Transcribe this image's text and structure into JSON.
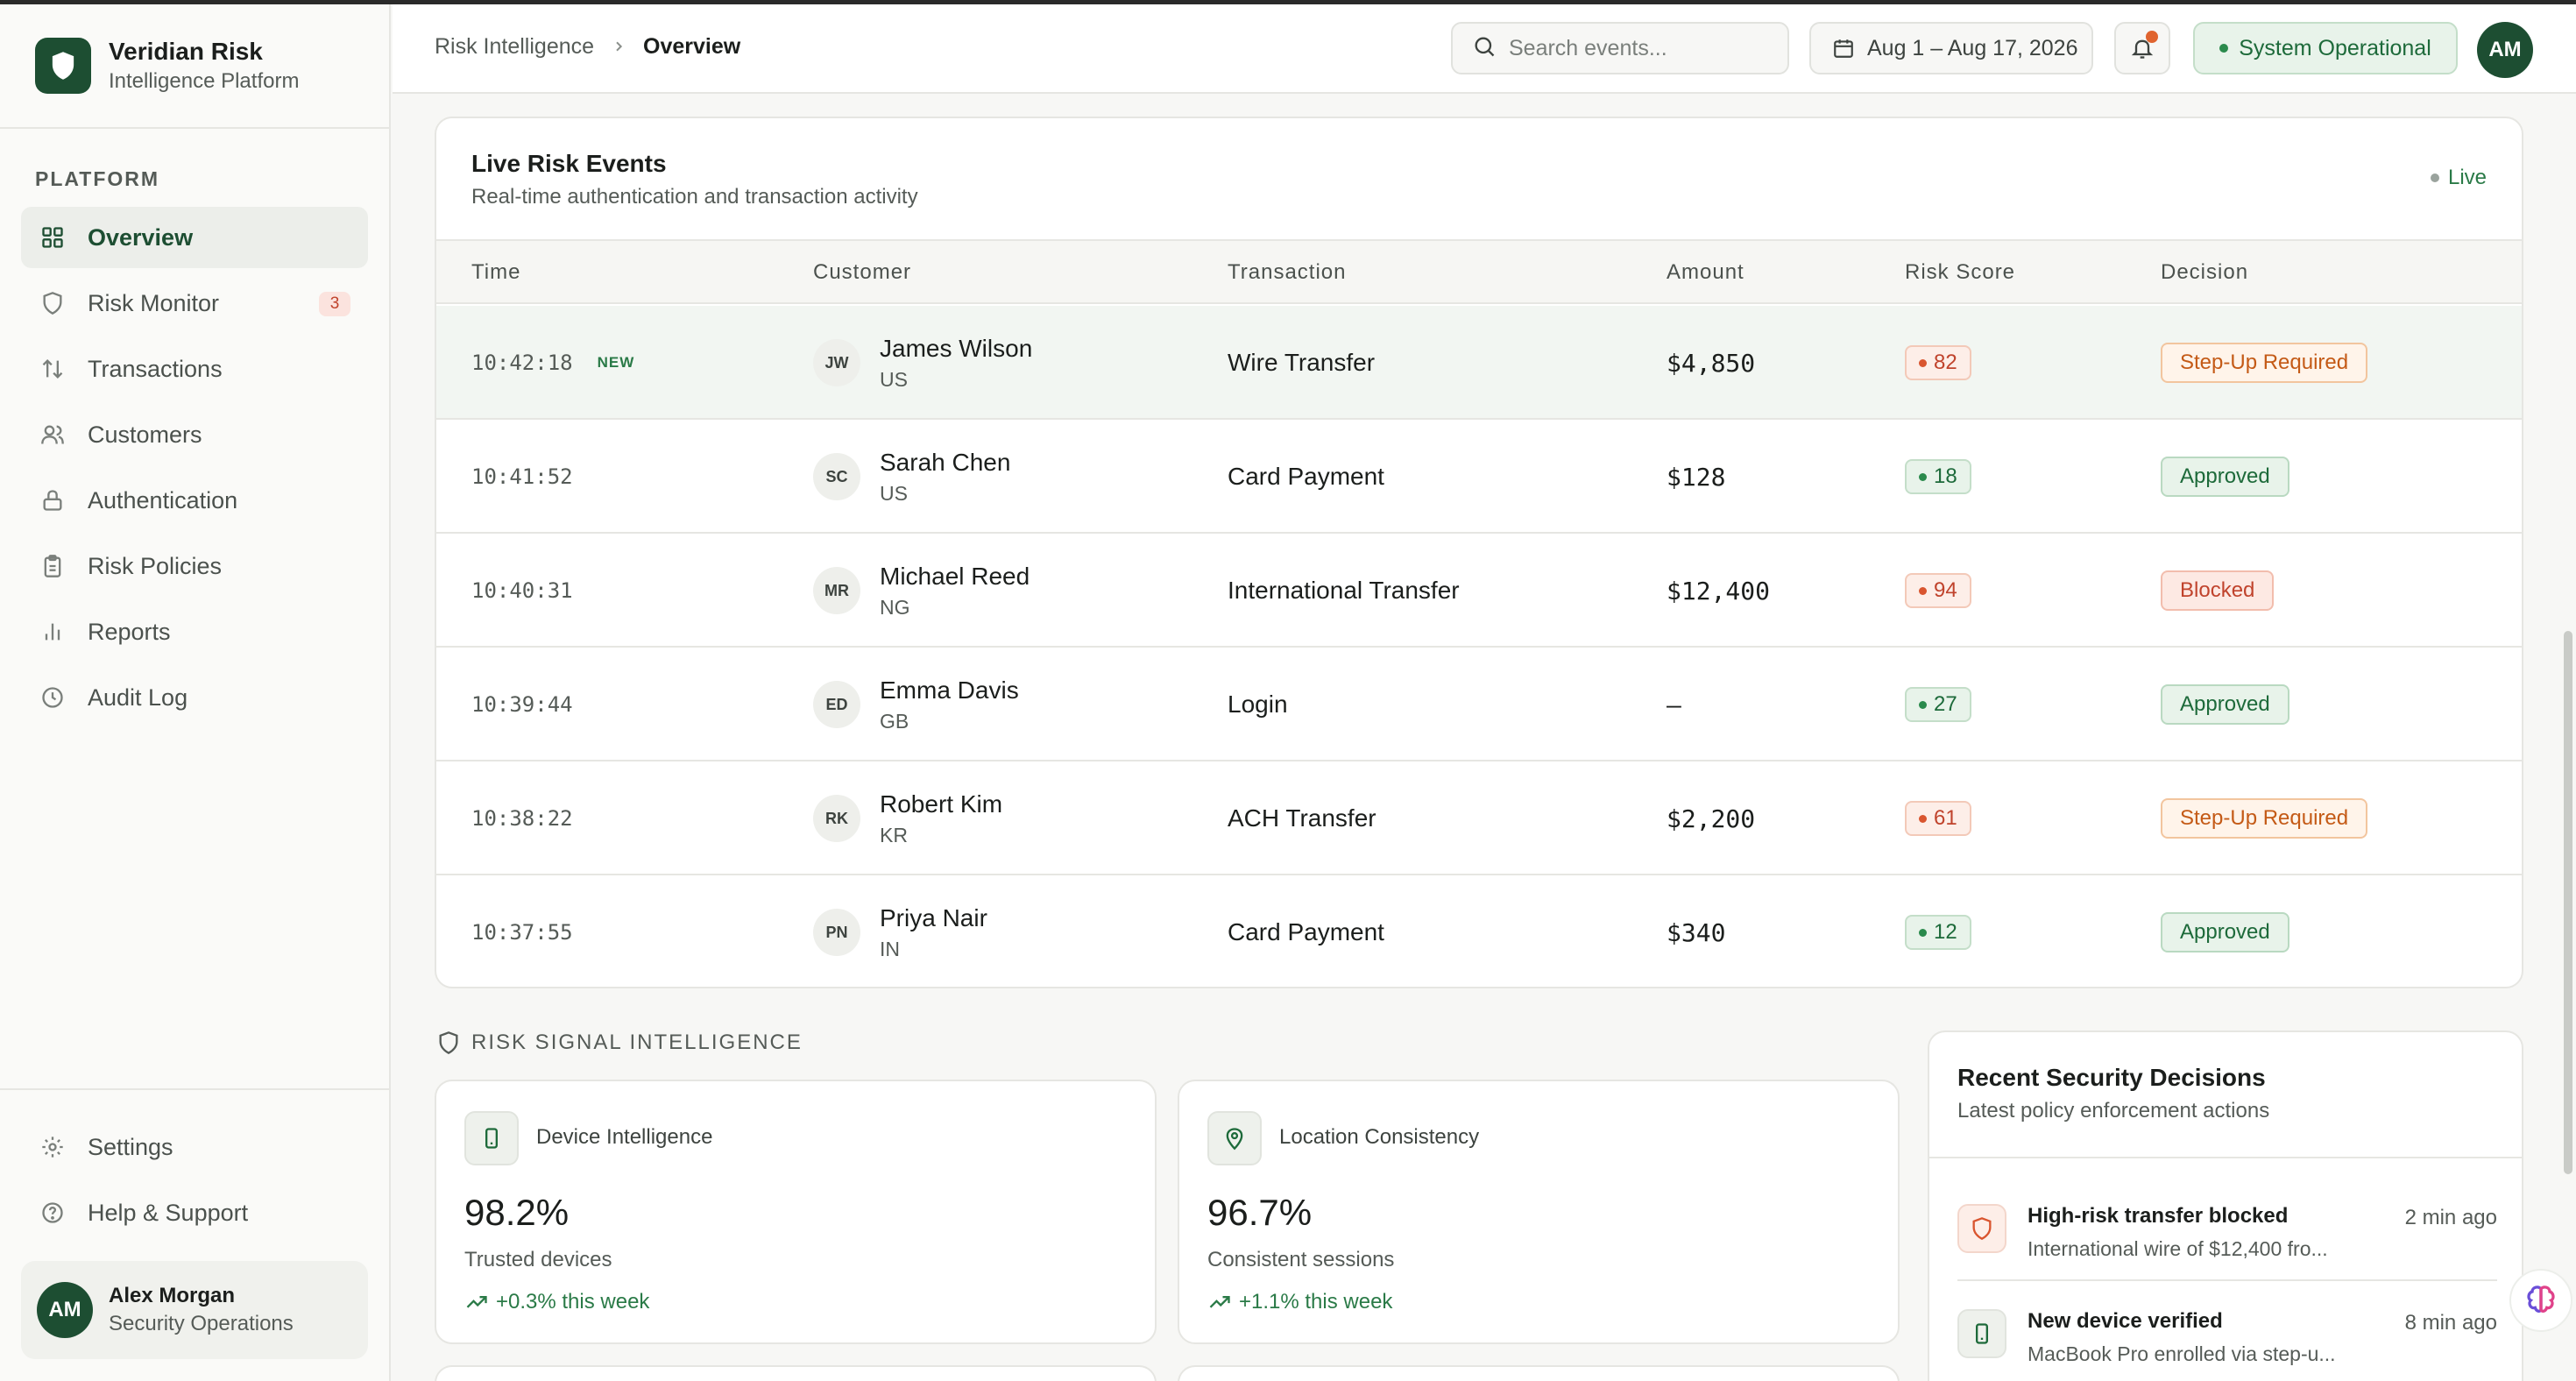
{
  "brand": {
    "name": "Veridian Risk",
    "subtitle": "Intelligence Platform"
  },
  "sidebar": {
    "section_label": "PLATFORM",
    "items": [
      {
        "label": "Overview",
        "icon": "grid-icon",
        "active": true
      },
      {
        "label": "Risk Monitor",
        "icon": "shield-icon",
        "badge": "3"
      },
      {
        "label": "Transactions",
        "icon": "arrows-updown-icon"
      },
      {
        "label": "Customers",
        "icon": "users-icon"
      },
      {
        "label": "Authentication",
        "icon": "lock-icon"
      },
      {
        "label": "Risk Policies",
        "icon": "clipboard-icon"
      },
      {
        "label": "Reports",
        "icon": "bar-chart-icon"
      },
      {
        "label": "Audit Log",
        "icon": "clock-icon"
      }
    ],
    "bottom": {
      "settings": "Settings",
      "help": "Help & Support"
    },
    "user": {
      "initials": "AM",
      "name": "Alex Morgan",
      "role": "Security Operations"
    }
  },
  "header": {
    "breadcrumb_parent": "Risk Intelligence",
    "breadcrumb_current": "Overview",
    "search_placeholder": "Search events...",
    "date_range": "Aug 1 – Aug 17, 2026",
    "status": "System Operational",
    "avatar_initials": "AM"
  },
  "events": {
    "title": "Live Risk Events",
    "subtitle": "Real-time authentication and transaction activity",
    "live_label": "Live",
    "columns": [
      "Time",
      "Customer",
      "Transaction",
      "Amount",
      "Risk Score",
      "Decision"
    ],
    "new_tag": "NEW",
    "rows": [
      {
        "time": "10:42:18",
        "new": true,
        "initials": "JW",
        "name": "James Wilson",
        "country": "US",
        "transaction": "Wire Transfer",
        "amount": "$4,850",
        "score": "82",
        "score_level": "high",
        "decision": "Step-Up Required",
        "decision_type": "stepup"
      },
      {
        "time": "10:41:52",
        "initials": "SC",
        "name": "Sarah Chen",
        "country": "US",
        "transaction": "Card Payment",
        "amount": "$128",
        "score": "18",
        "score_level": "low",
        "decision": "Approved",
        "decision_type": "approved"
      },
      {
        "time": "10:40:31",
        "initials": "MR",
        "name": "Michael Reed",
        "country": "NG",
        "transaction": "International Transfer",
        "amount": "$12,400",
        "score": "94",
        "score_level": "high",
        "decision": "Blocked",
        "decision_type": "blocked"
      },
      {
        "time": "10:39:44",
        "initials": "ED",
        "name": "Emma Davis",
        "country": "GB",
        "transaction": "Login",
        "amount": "—",
        "score": "27",
        "score_level": "low",
        "decision": "Approved",
        "decision_type": "approved"
      },
      {
        "time": "10:38:22",
        "initials": "RK",
        "name": "Robert Kim",
        "country": "KR",
        "transaction": "ACH Transfer",
        "amount": "$2,200",
        "score": "61",
        "score_level": "high",
        "decision": "Step-Up Required",
        "decision_type": "stepup"
      },
      {
        "time": "10:37:55",
        "initials": "PN",
        "name": "Priya Nair",
        "country": "IN",
        "transaction": "Card Payment",
        "amount": "$340",
        "score": "12",
        "score_level": "low",
        "decision": "Approved",
        "decision_type": "approved"
      }
    ]
  },
  "signals": {
    "section_label": "RISK SIGNAL INTELLIGENCE",
    "cards": [
      {
        "title": "Device Intelligence",
        "icon": "smartphone-icon",
        "value": "98.2%",
        "desc": "Trusted devices",
        "delta": "+0.3% this week"
      },
      {
        "title": "Location Consistency",
        "icon": "map-pin-icon",
        "value": "96.7%",
        "desc": "Consistent sessions",
        "delta": "+1.1% this week"
      }
    ]
  },
  "decisions": {
    "title": "Recent Security Decisions",
    "subtitle": "Latest policy enforcement actions",
    "items": [
      {
        "heading": "High-risk transfer blocked",
        "text": "International wire of $12,400 fro...",
        "time": "2 min ago",
        "icon": "shield-icon"
      },
      {
        "heading": "New device verified",
        "text": "MacBook Pro enrolled via step-u...",
        "time": "8 min ago",
        "icon": "smartphone-icon"
      }
    ]
  },
  "colors": {
    "brand": "#1d4e32",
    "danger": "#c0432c",
    "warning": "#c45a16",
    "success": "#1d6a3a"
  }
}
